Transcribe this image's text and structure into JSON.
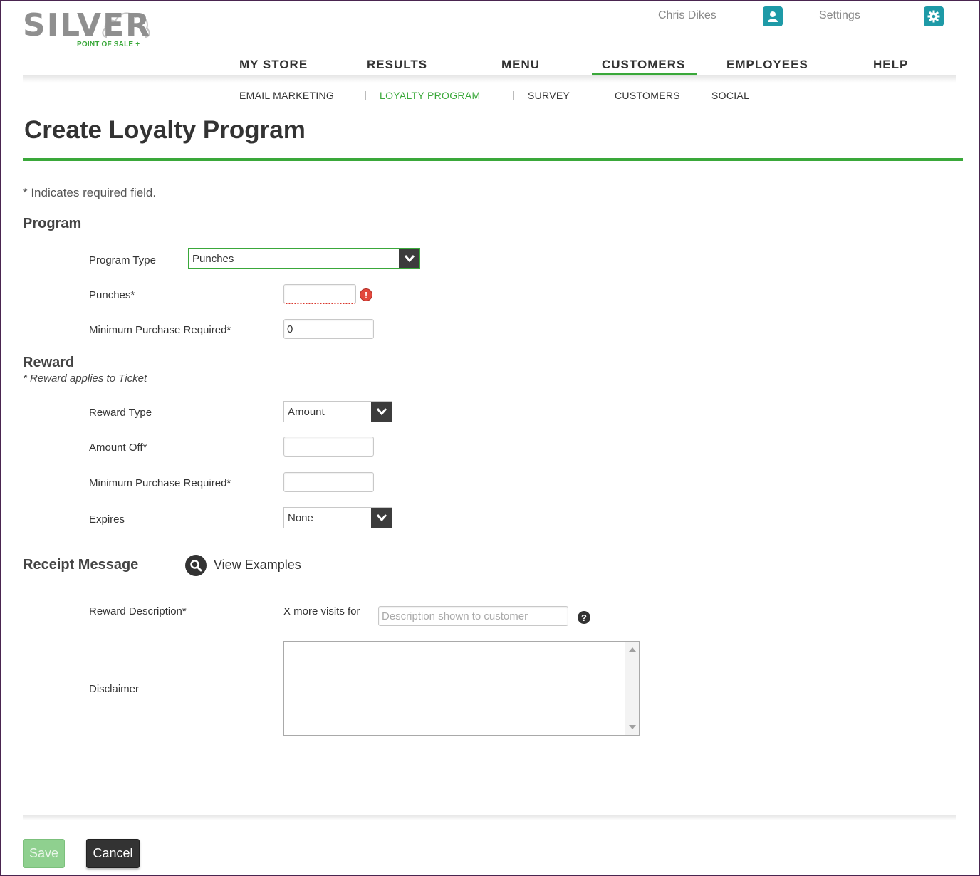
{
  "brand": {
    "name": "SILVER",
    "tagline": "POINT OF SALE +",
    "accent_color": "#3aa83a",
    "teal_color": "#1e9aa7"
  },
  "user_bar": {
    "user_name": "Chris Dikes",
    "user_icon": "user-icon",
    "settings_label": "Settings",
    "settings_icon": "gear-icon"
  },
  "main_nav": {
    "items": [
      "MY STORE",
      "RESULTS",
      "MENU",
      "CUSTOMERS",
      "EMPLOYEES",
      "HELP"
    ],
    "active": "CUSTOMERS"
  },
  "sub_nav": {
    "items": [
      "EMAIL MARKETING",
      "LOYALTY PROGRAM",
      "SURVEY",
      "CUSTOMERS",
      "SOCIAL"
    ],
    "active": "LOYALTY PROGRAM"
  },
  "page": {
    "title": "Create Loyalty Program",
    "required_note": "* Indicates required field."
  },
  "program": {
    "heading": "Program",
    "program_type_label": "Program Type",
    "program_type_value": "Punches",
    "punches_label": "Punches*",
    "punches_value": "",
    "min_purchase_label": "Minimum Purchase Required*",
    "min_purchase_value": "0"
  },
  "reward": {
    "heading": "Reward",
    "subnote": "* Reward applies to Ticket",
    "reward_type_label": "Reward Type",
    "reward_type_value": "Amount",
    "amount_off_label": "Amount Off*",
    "amount_off_value": "",
    "min_purchase_label": "Minimum Purchase Required*",
    "min_purchase_value": "",
    "expires_label": "Expires",
    "expires_value": "None"
  },
  "receipt": {
    "heading": "Receipt Message",
    "view_examples": "View Examples",
    "reward_description_label": "Reward Description*",
    "prefix_text": "X more visits for",
    "description_placeholder": "Description shown to customer",
    "disclaimer_label": "Disclaimer",
    "disclaimer_value": ""
  },
  "actions": {
    "save_label": "Save",
    "cancel_label": "Cancel"
  }
}
